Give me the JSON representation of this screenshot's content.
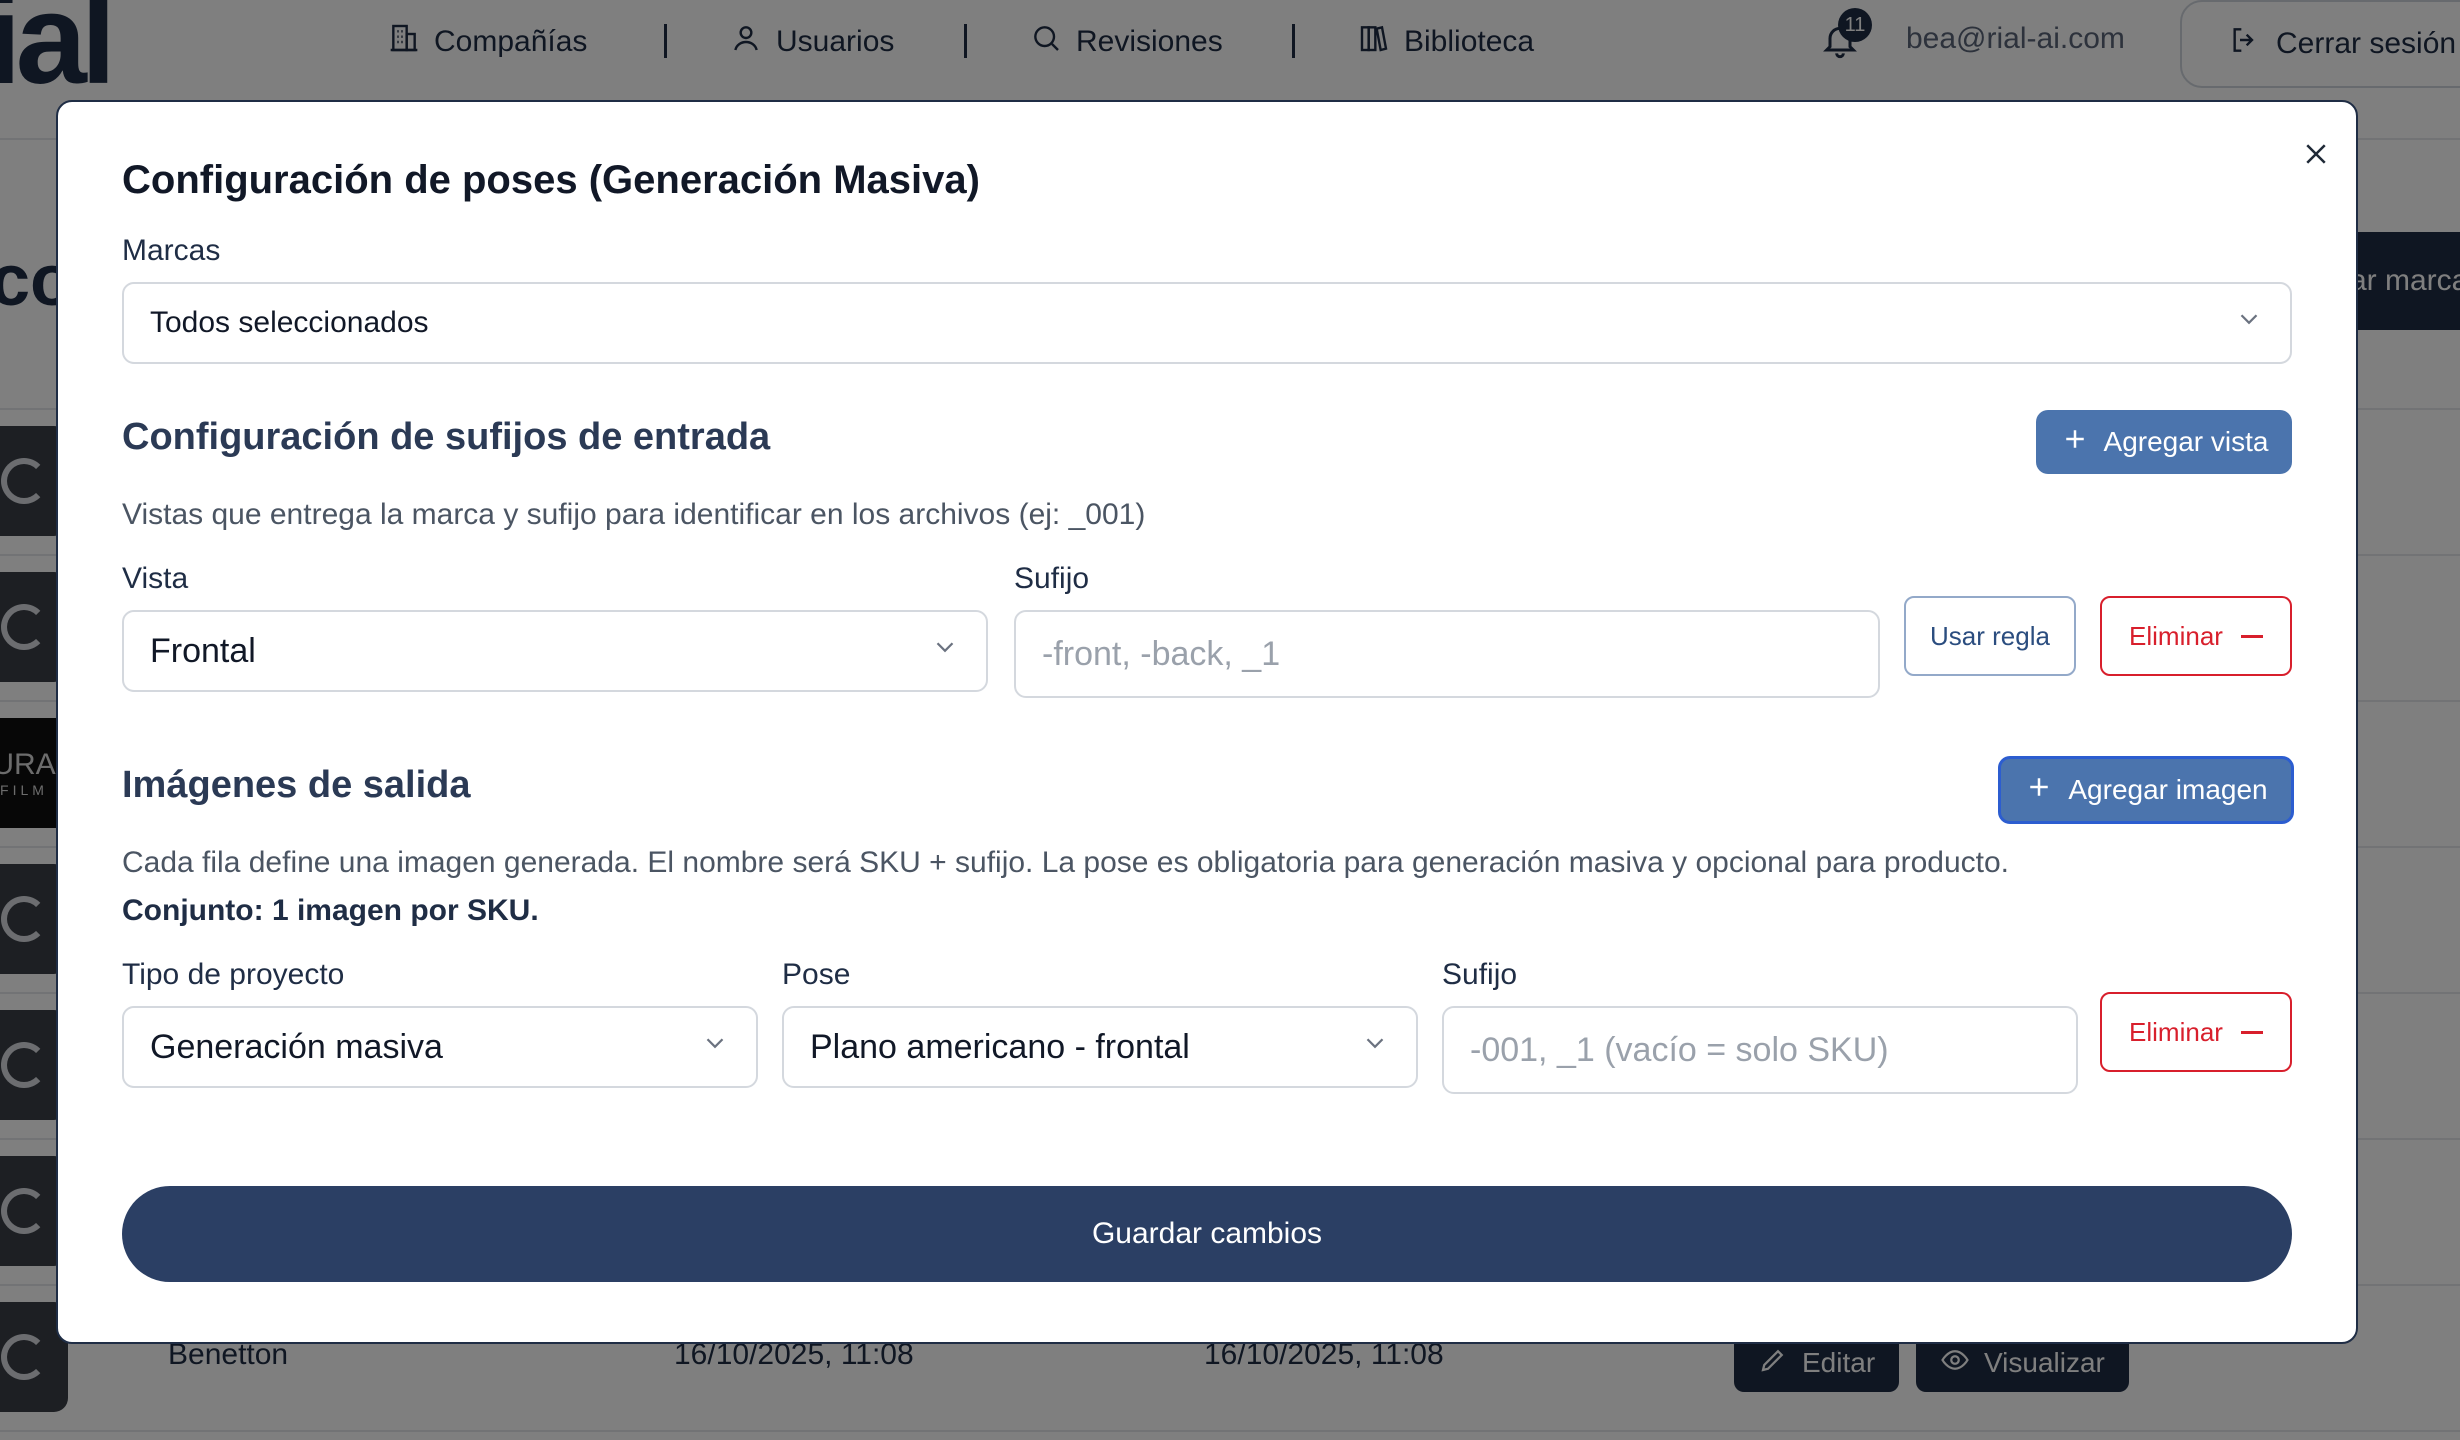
{
  "nav": {
    "logo": "ial",
    "items": [
      {
        "label": "Compañías",
        "icon": "building-icon"
      },
      {
        "label": "Usuarios",
        "icon": "user-icon"
      },
      {
        "label": "Revisiones",
        "icon": "search-icon"
      },
      {
        "label": "Biblioteca",
        "icon": "books-icon"
      }
    ],
    "notification_count": "11",
    "user_email": "bea@rial-ai.com",
    "logout_label": "Cerrar sesión"
  },
  "background": {
    "title_fragment": "co",
    "add_button_label": "ar marca",
    "thumb_logo_text": "URA",
    "thumb_logo_sub": "FILM",
    "last_row": {
      "name": "Benetton",
      "created": "16/10/2025, 11:08",
      "updated": "16/10/2025, 11:08",
      "edit_label": "Editar",
      "view_label": "Visualizar"
    }
  },
  "modal": {
    "title": "Configuración de poses (Generación Masiva)",
    "brands_label": "Marcas",
    "brands_value": "Todos seleccionados",
    "input_section": {
      "title": "Configuración de sufijos de entrada",
      "add_button": "Agregar vista",
      "help": "Vistas que entrega la marca y sufijo para identificar en los archivos (ej: _001)",
      "view_label": "Vista",
      "view_value": "Frontal",
      "suffix_label": "Sufijo",
      "suffix_placeholder": "-front, -back, _1",
      "use_rule_button": "Usar regla",
      "delete_button": "Eliminar"
    },
    "output_section": {
      "title": "Imágenes de salida",
      "add_button": "Agregar imagen",
      "help": "Cada fila define una imagen generada. El nombre será SKU + sufijo. La pose es obligatoria para generación masiva y opcional para producto.",
      "summary": "Conjunto: 1 imagen por SKU.",
      "project_type_label": "Tipo de proyecto",
      "project_type_value": "Generación masiva",
      "pose_label": "Pose",
      "pose_value": "Plano americano - frontal",
      "suffix_label": "Sufijo",
      "suffix_placeholder": "-001, _1 (vacío = solo SKU)",
      "delete_button": "Eliminar"
    },
    "save_button": "Guardar cambios"
  },
  "colors": {
    "navy": "#1f2d45",
    "primary_blue": "#4b74ad",
    "danger_red": "#d81f2c",
    "save_button": "#2b3f64"
  }
}
